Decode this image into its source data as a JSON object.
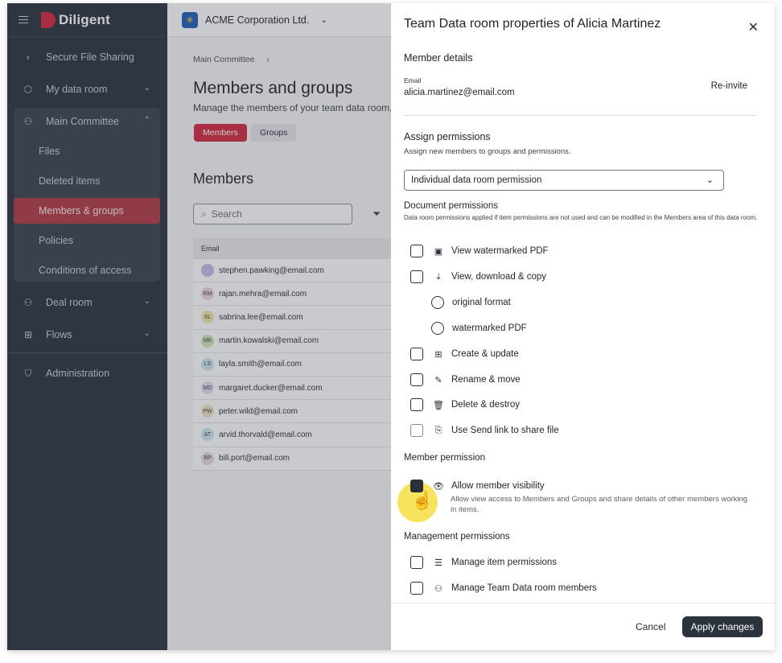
{
  "app": {
    "logo_text": "Diligent",
    "org_name": "ACME Corporation Ltd."
  },
  "sidebar": {
    "back_label": "Secure File Sharing",
    "items": [
      {
        "label": "My data room",
        "icon": "hexagon-icon"
      },
      {
        "label": "Main Committee",
        "icon": "people-icon"
      },
      {
        "label": "Deal room",
        "icon": "people-icon"
      },
      {
        "label": "Flows",
        "icon": "flow-icon"
      },
      {
        "label": "Administration",
        "icon": "shield-icon"
      }
    ],
    "sub_items": [
      {
        "label": "Files"
      },
      {
        "label": "Deleted items"
      },
      {
        "label": "Members & groups"
      },
      {
        "label": "Policies"
      },
      {
        "label": "Conditions of access"
      }
    ]
  },
  "main": {
    "breadcrumb": "Main Committee",
    "title": "Members and groups",
    "description": "Manage the members of your team data room, cr",
    "tabs": [
      {
        "label": "Members"
      },
      {
        "label": "Groups"
      }
    ],
    "section_title": "Members",
    "search_placeholder": "Search",
    "table_header": "Email",
    "rows": [
      {
        "initials": "",
        "email": "stephen.pawking@email.com",
        "color": "#c9b9e8"
      },
      {
        "initials": "RM",
        "email": "rajan.mehra@email.com",
        "color": "#f0d6dc"
      },
      {
        "initials": "SL",
        "email": "sabrina.lee@email.com",
        "color": "#f3e7a8"
      },
      {
        "initials": "MK",
        "email": "martin.kowalski@email.com",
        "color": "#cfe7b8"
      },
      {
        "initials": "LS",
        "email": "layla.smith@email.com",
        "color": "#cde3f3"
      },
      {
        "initials": "MD",
        "email": "margaret.ducker@email.com",
        "color": "#e7dcef"
      },
      {
        "initials": "PW",
        "email": "peter.wild@email.com",
        "color": "#f2e2c9"
      },
      {
        "initials": "AT",
        "email": "arvid.thorvald@email.com",
        "color": "#cde3f3"
      },
      {
        "initials": "BP",
        "email": "bill.port@email.com",
        "color": "#ead8e0"
      }
    ]
  },
  "panel": {
    "title": "Team Data room properties of Alicia Martinez",
    "member_details": "Member details",
    "email_label": "Email",
    "email": "alicia.martinez@email.com",
    "reinvite": "Re-invite",
    "assign_title": "Assign permissions",
    "assign_note": "Assign new members to groups and permissions.",
    "select_value": "Individual data room permission",
    "doc_title": "Document permissions",
    "doc_note": "Data room permissions applied if item permissions are not used and can be modified in the Members area of this data room.",
    "doc_perms": [
      {
        "label": "View watermarked PDF",
        "icon": "▣"
      },
      {
        "label": "View, download & copy",
        "icon": "⤓"
      },
      {
        "label": "Create & update",
        "icon": "⊞"
      },
      {
        "label": "Rename & move",
        "icon": "✎"
      },
      {
        "label": "Delete & destroy",
        "icon": "🗑"
      },
      {
        "label": "Use Send link to share file",
        "icon": "⎘"
      }
    ],
    "radios": [
      {
        "label": "original format"
      },
      {
        "label": "watermarked PDF"
      }
    ],
    "member_perm_title": "Member permission",
    "member_perm": {
      "label": "Allow member visibility",
      "icon": "👁",
      "checked": true,
      "note": "Allow view access to Members and Groups and share details of other members working in items."
    },
    "mgmt_title": "Management permissions",
    "mgmt_perms": [
      {
        "label": "Manage item permissions",
        "icon": "☰"
      },
      {
        "label": "Manage Team Data room members",
        "icon": "⚇"
      }
    ],
    "cancel": "Cancel",
    "apply": "Apply changes"
  }
}
